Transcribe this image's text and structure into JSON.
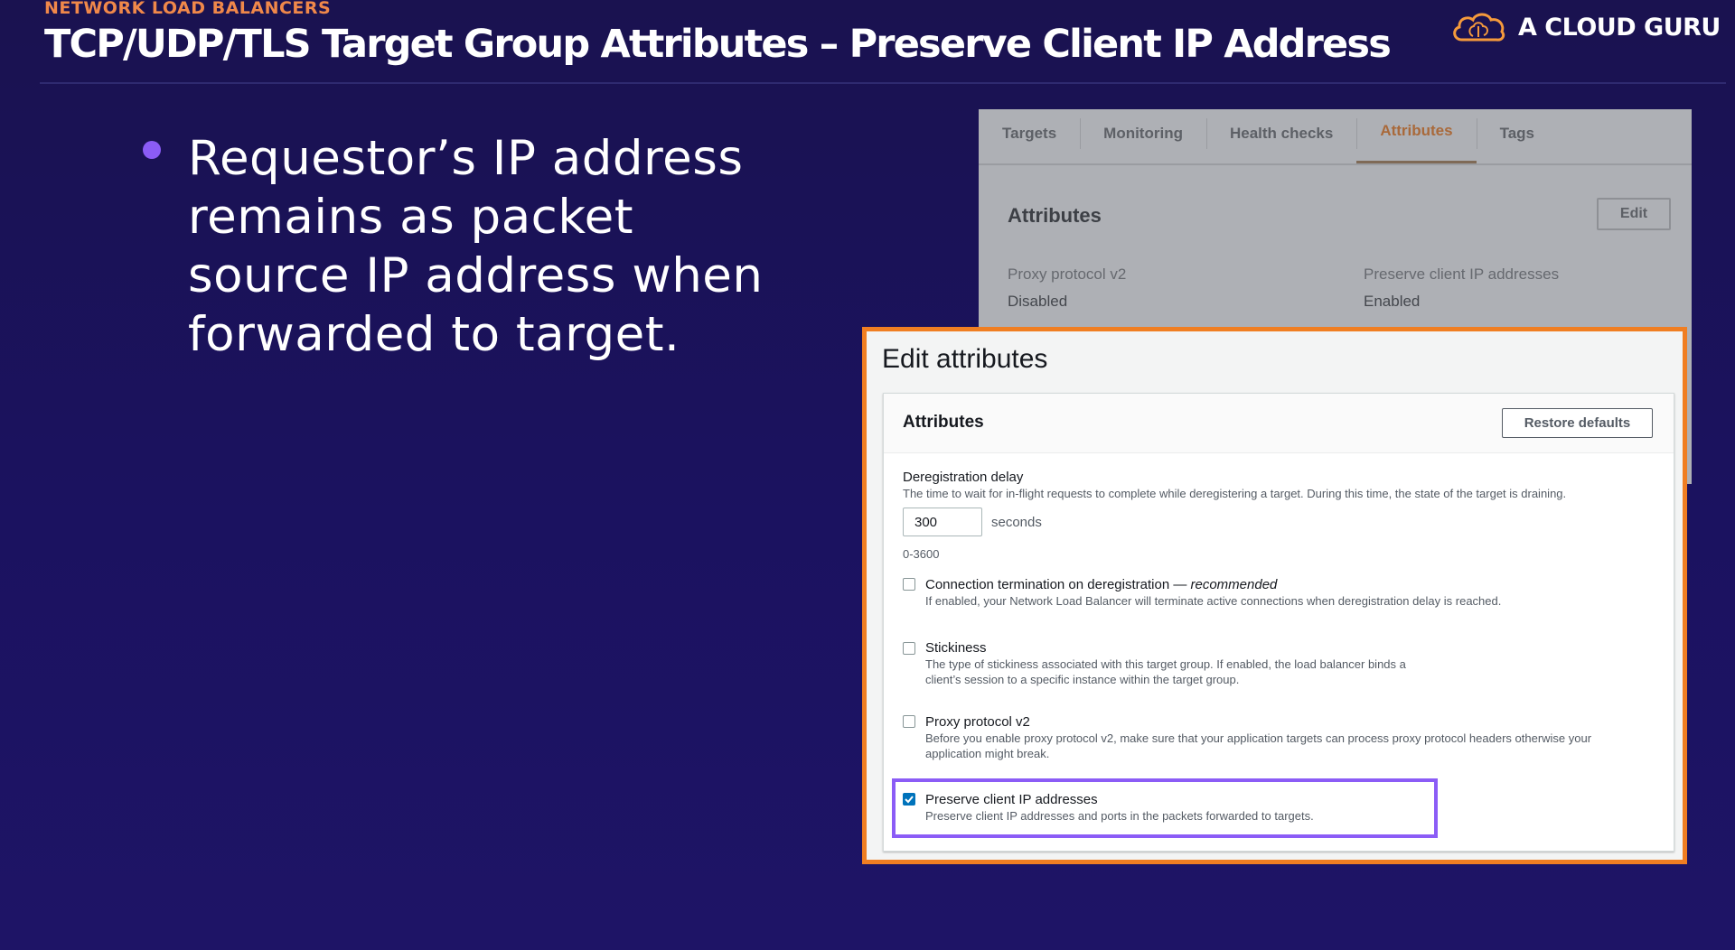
{
  "slide": {
    "eyebrow": "NETWORK LOAD BALANCERS",
    "title": "TCP/UDP/TLS Target Group Attributes – Preserve Client IP Address",
    "logo_text": "A CLOUD GURU",
    "bullet": "Requestor’s IP address remains as packet source IP address when forwarded to target."
  },
  "console_bg": {
    "tabs": [
      {
        "label": "Targets"
      },
      {
        "label": "Monitoring"
      },
      {
        "label": "Health checks"
      },
      {
        "label": "Attributes",
        "active": true
      },
      {
        "label": "Tags"
      }
    ],
    "section_title": "Attributes",
    "edit_label": "Edit",
    "fields": [
      {
        "label": "Proxy protocol v2",
        "value": "Disabled"
      },
      {
        "label": "Preserve client IP addresses",
        "value": "Enabled"
      }
    ]
  },
  "modal": {
    "title": "Edit attributes",
    "card_title": "Attributes",
    "restore_label": "Restore defaults",
    "deregistration": {
      "label": "Deregistration delay",
      "desc": "The time to wait for in-flight requests to complete while deregistering a target. During this time, the state of the target is draining.",
      "value": "300",
      "units": "seconds",
      "range": "0-3600"
    },
    "options": [
      {
        "label": "Connection termination on deregistration — ",
        "label_em": "recommended",
        "desc": "If enabled, your Network Load Balancer will terminate active connections when deregistration delay is reached.",
        "checked": false
      },
      {
        "label": "Stickiness",
        "desc": "The type of stickiness associated with this target group. If enabled, the load balancer binds a client’s session to a specific instance within the target group.",
        "checked": false
      },
      {
        "label": "Proxy protocol v2",
        "desc": "Before you enable proxy protocol v2, make sure that your application targets can process proxy protocol headers otherwise your application might break.",
        "checked": false
      },
      {
        "label": "Preserve client IP addresses",
        "desc": "Preserve client IP addresses and ports in the packets forwarded to targets.",
        "checked": true
      }
    ]
  },
  "colors": {
    "accent_orange": "#f07e22",
    "highlight_purple": "#8b5cf6",
    "checkbox_blue": "#0073bb"
  }
}
